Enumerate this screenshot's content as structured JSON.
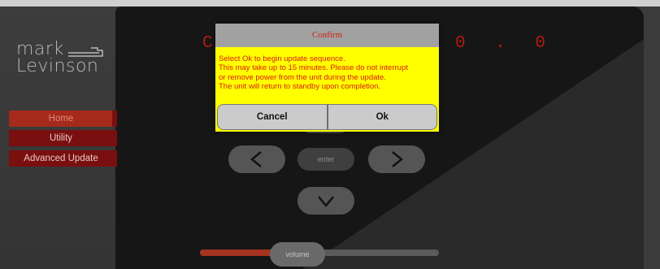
{
  "brand": {
    "line1": "mark",
    "line2": "Levinson"
  },
  "nav": {
    "items": [
      {
        "label": "Home"
      },
      {
        "label": "Utility"
      },
      {
        "label": "Advanced Update"
      }
    ]
  },
  "display": {
    "left_char": "C",
    "right_chars": "0 . 0"
  },
  "controls": {
    "enter_label": "enter",
    "volume_label": "volume",
    "volume_level": 0.3
  },
  "dialog": {
    "title": "Confirm",
    "message_lines": [
      "Select Ok to begin update sequence.",
      "This may take up to 15 minutes. Please do not interrupt",
      "or remove power from the unit during the update.",
      "The unit will return to standby upon completion."
    ],
    "cancel_label": "Cancel",
    "ok_label": "Ok"
  },
  "colors": {
    "accent_red": "#b51a12",
    "dialog_bg": "#ffff00",
    "nav_active": "#a52a1b",
    "nav_inactive": "#7a0f0f"
  }
}
